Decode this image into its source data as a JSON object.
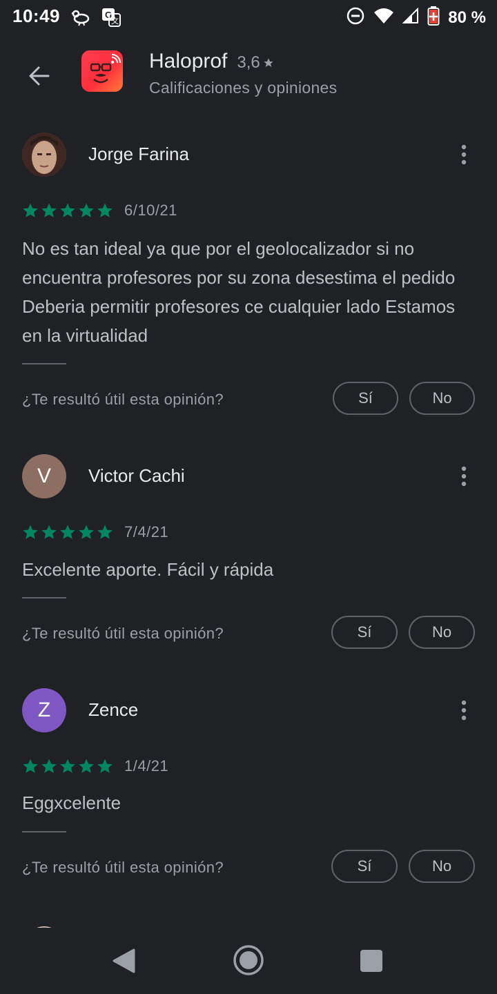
{
  "status_bar": {
    "time": "10:49",
    "battery_percent": "80 %",
    "icons": [
      "bird-icon",
      "translate-icon",
      "dnd-icon",
      "wifi-icon",
      "signal-icon",
      "battery-icon"
    ]
  },
  "header": {
    "app_name": "Haloprof",
    "rating": "3,6",
    "subtitle": "Calificaciones y opiniones"
  },
  "colors": {
    "star_green": "#01875f",
    "background": "#202124"
  },
  "reviews": [
    {
      "name": "Jorge Farina",
      "avatar_type": "photo",
      "stars": 5,
      "date": "6/10/21",
      "text": "No es tan ideal ya que por el geolocalizador si no encuentra profesores por su zona desestima el pedido Deberia permitir profesores ce cualquier lado Estamos en la virtualidad",
      "helpful_prompt": "¿Te resultó útil esta opinión?",
      "yes_label": "Sí",
      "no_label": "No"
    },
    {
      "name": "Victor Cachi",
      "avatar_letter": "V",
      "avatar_color": "#8d6e63",
      "stars": 5,
      "date": "7/4/21",
      "text": "Excelente aporte. Fácil y rápida",
      "helpful_prompt": "¿Te resultó útil esta opinión?",
      "yes_label": "Sí",
      "no_label": "No"
    },
    {
      "name": "Zence",
      "avatar_letter": "Z",
      "avatar_color": "#7e57c2",
      "stars": 5,
      "date": "1/4/21",
      "text": "Eggxcelente",
      "helpful_prompt": "¿Te resultó útil esta opinión?",
      "yes_label": "Sí",
      "no_label": "No"
    }
  ]
}
